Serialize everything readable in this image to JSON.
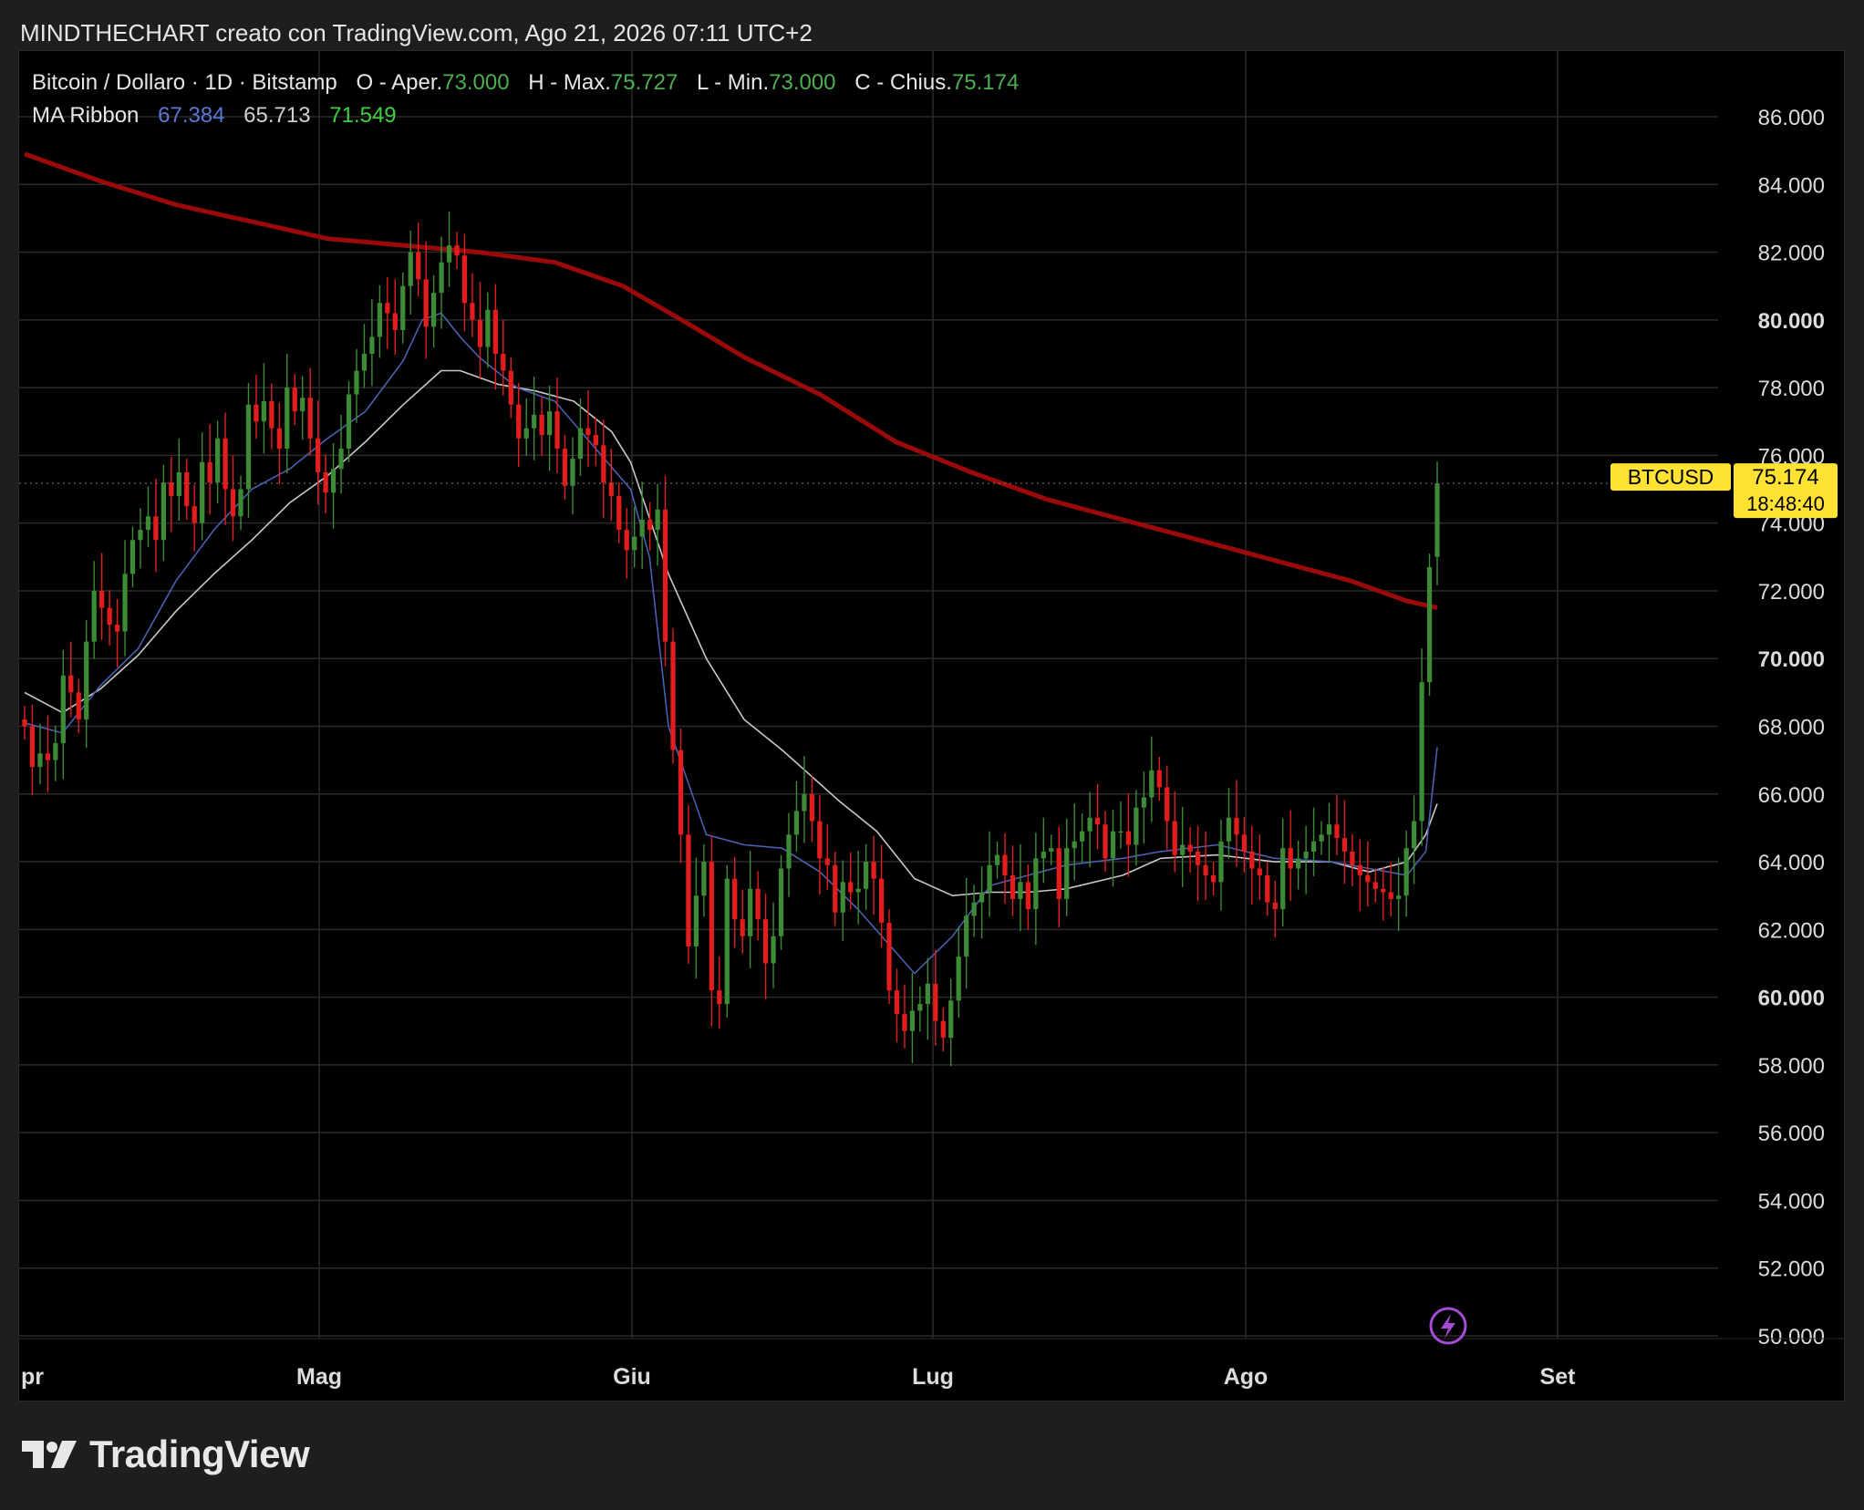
{
  "header": {
    "text": "MINDTHECHART creato con TradingView.com, Ago 21, 2026 07:11 UTC+2"
  },
  "legend": {
    "symbol": "Bitcoin / Dollaro · 1D · Bitstamp",
    "open_label": "O - Aper.",
    "open_value": "73.000",
    "high_label": "H - Max.",
    "high_value": "75.727",
    "low_label": "L - Min.",
    "low_value": "73.000",
    "close_label": "C - Chius.",
    "close_value": "75.174",
    "ma_label": "MA Ribbon",
    "ma_values": [
      "67.384",
      "65.713",
      "71.549"
    ]
  },
  "colors": {
    "up": "#3d8b37",
    "down": "#e31d1d",
    "ma_long": "#9b0a0a",
    "ma_fast": "#4a5fb0",
    "ma_mid": "#c8c8c8",
    "ma_val1": "#5b77d6",
    "ma_val2": "#d0d0d0",
    "ma_val3": "#3fd13f",
    "price_tag": "#ffe233",
    "grid": "#2b2b2b",
    "axis_text": "#dcdcdc"
  },
  "price_tag": {
    "symbol": "BTCUSD",
    "price": "75.174",
    "countdown": "18:48:40"
  },
  "footer": {
    "brand": "TradingView"
  },
  "icons": {
    "bolt": "lightning-icon"
  },
  "chart_data": {
    "type": "candlestick",
    "title": "",
    "ylim": [
      50000,
      86000
    ],
    "y_ticks": [
      "50.000",
      "52.000",
      "54.000",
      "56.000",
      "58.000",
      "60.000",
      "62.000",
      "64.000",
      "66.000",
      "68.000",
      "70.000",
      "72.000",
      "74.000",
      "76.000",
      "78.000",
      "80.000",
      "82.000",
      "84.000",
      "86.000"
    ],
    "bold_ticks": [
      "60.000",
      "70.000",
      "80.000"
    ],
    "x_labels": [
      {
        "label": "pr",
        "date": "2026-04-01"
      },
      {
        "label": "Mag",
        "date": "2026-05-01"
      },
      {
        "label": "Giu",
        "date": "2026-06-01"
      },
      {
        "label": "Lug",
        "date": "2026-07-01"
      },
      {
        "label": "Ago",
        "date": "2026-08-01"
      },
      {
        "label": "Set",
        "date": "2026-09-01"
      }
    ],
    "last_price": 75174,
    "candles_close": [
      68000,
      66800,
      67200,
      67000,
      67500,
      69500,
      69000,
      68200,
      70500,
      72000,
      71500,
      71000,
      70800,
      72500,
      73500,
      73800,
      74200,
      73500,
      75200,
      74800,
      75500,
      74500,
      74000,
      75800,
      75200,
      76500,
      75000,
      74200,
      75000,
      77500,
      77000,
      77600,
      76800,
      76200,
      78000,
      77300,
      77700,
      76500,
      75500,
      74900,
      75600,
      76200,
      77800,
      78500,
      79000,
      79500,
      80500,
      80200,
      79700,
      81000,
      82000,
      81200,
      79800,
      80800,
      81700,
      82200,
      81900,
      80500,
      80000,
      79200,
      80300,
      79000,
      78500,
      77500,
      76500,
      76800,
      77200,
      76600,
      77300,
      76200,
      75100,
      75900,
      76800,
      76600,
      76300,
      75200,
      74800,
      73800,
      73200,
      73600,
      74100,
      73800,
      74400,
      70500,
      67300,
      64800,
      61500,
      63000,
      64000,
      60200,
      59800,
      63500,
      62300,
      61800,
      63200,
      62300,
      61000,
      61800,
      63800,
      64800,
      65500,
      66000,
      65200,
      64100,
      63900,
      62500,
      63400,
      63100,
      63200,
      64000,
      63500,
      62200,
      60200,
      59500,
      59000,
      59600,
      59800,
      60400,
      59300,
      58800,
      59900,
      61200,
      62400,
      62800,
      63100,
      63900,
      64200,
      63600,
      62900,
      63400,
      62600,
      64100,
      64300,
      64400,
      62900,
      64400,
      64600,
      64900,
      65300,
      65100,
      64100,
      64900,
      64900,
      64500,
      65600,
      65900,
      66700,
      66200,
      65200,
      64200,
      64500,
      64300,
      63900,
      63600,
      63400,
      64600,
      65300,
      64800,
      64300,
      63800,
      63600,
      62800,
      62600,
      64400,
      63800,
      64100,
      64300,
      64600,
      64800,
      65100,
      64700,
      64300,
      63900,
      63600,
      63400,
      63200,
      63100,
      62900,
      63000,
      64400,
      65200,
      69300,
      72700,
      75174
    ],
    "candles_open": [
      68200,
      68000,
      66800,
      67200,
      67000,
      67500,
      69500,
      69000,
      68200,
      70500,
      72000,
      71500,
      71000,
      70800,
      72500,
      73500,
      73800,
      74200,
      73500,
      75200,
      74800,
      75500,
      74500,
      74000,
      75800,
      75200,
      76500,
      75000,
      74200,
      75000,
      77500,
      77000,
      77600,
      76800,
      76200,
      78000,
      77300,
      77700,
      76500,
      75500,
      74900,
      75600,
      76200,
      77800,
      78500,
      79000,
      79500,
      80500,
      80200,
      79700,
      81000,
      82000,
      81200,
      79800,
      80800,
      81700,
      82200,
      81900,
      80500,
      80000,
      79200,
      80300,
      79000,
      78500,
      77500,
      76500,
      76800,
      77200,
      76600,
      77300,
      76200,
      75100,
      75900,
      76800,
      76600,
      76300,
      75200,
      74800,
      73800,
      73200,
      73600,
      74100,
      73800,
      74400,
      70500,
      67300,
      64800,
      61500,
      63000,
      64000,
      60200,
      59800,
      63500,
      62300,
      61800,
      63200,
      62300,
      61000,
      61800,
      63800,
      64800,
      65500,
      66000,
      65200,
      64100,
      63900,
      62500,
      63400,
      63100,
      63200,
      64000,
      63500,
      62200,
      60200,
      59500,
      59000,
      59600,
      59800,
      60400,
      59300,
      58800,
      59900,
      61200,
      62400,
      62800,
      63100,
      63900,
      64200,
      63600,
      62900,
      63400,
      62600,
      64100,
      64300,
      64400,
      62900,
      64400,
      64600,
      64900,
      65300,
      65100,
      64100,
      64900,
      64900,
      64500,
      65600,
      65900,
      66700,
      66200,
      65200,
      64200,
      64500,
      64300,
      63900,
      63600,
      63400,
      64600,
      65300,
      64800,
      64300,
      63800,
      63600,
      62800,
      62600,
      64400,
      63800,
      64100,
      64300,
      64600,
      64800,
      65100,
      64700,
      64300,
      63900,
      63600,
      63400,
      63200,
      63100,
      62900,
      63000,
      64400,
      65200,
      69300,
      73000
    ],
    "ma_long_points": [
      [
        0,
        84900
      ],
      [
        20,
        84100
      ],
      [
        40,
        83400
      ],
      [
        60,
        82900
      ],
      [
        80,
        82400
      ],
      [
        100,
        82200
      ],
      [
        120,
        82000
      ],
      [
        140,
        81700
      ],
      [
        158,
        81000
      ],
      [
        175,
        79900
      ],
      [
        190,
        78900
      ],
      [
        210,
        77800
      ],
      [
        230,
        76400
      ],
      [
        250,
        75500
      ],
      [
        270,
        74700
      ],
      [
        290,
        74100
      ],
      [
        310,
        73500
      ],
      [
        330,
        72900
      ],
      [
        350,
        72300
      ],
      [
        365,
        71700
      ],
      [
        373,
        71500
      ]
    ],
    "ma_fast_points": [
      [
        0,
        68100
      ],
      [
        10,
        67800
      ],
      [
        20,
        69200
      ],
      [
        30,
        70300
      ],
      [
        40,
        72300
      ],
      [
        50,
        73800
      ],
      [
        60,
        75000
      ],
      [
        70,
        75600
      ],
      [
        80,
        76500
      ],
      [
        90,
        77300
      ],
      [
        100,
        78800
      ],
      [
        105,
        80000
      ],
      [
        110,
        80200
      ],
      [
        115,
        79500
      ],
      [
        120,
        78900
      ],
      [
        130,
        78000
      ],
      [
        140,
        77600
      ],
      [
        150,
        76300
      ],
      [
        160,
        75000
      ],
      [
        165,
        73000
      ],
      [
        170,
        68000
      ],
      [
        180,
        64800
      ],
      [
        190,
        64500
      ],
      [
        200,
        64400
      ],
      [
        210,
        63700
      ],
      [
        220,
        62600
      ],
      [
        235,
        60700
      ],
      [
        245,
        61800
      ],
      [
        255,
        63300
      ],
      [
        265,
        63600
      ],
      [
        275,
        63900
      ],
      [
        290,
        64100
      ],
      [
        300,
        64300
      ],
      [
        315,
        64500
      ],
      [
        330,
        64100
      ],
      [
        345,
        64000
      ],
      [
        355,
        63800
      ],
      [
        365,
        63600
      ],
      [
        370,
        64300
      ],
      [
        373,
        67384
      ]
    ],
    "ma_mid_points": [
      [
        0,
        69000
      ],
      [
        10,
        68400
      ],
      [
        20,
        69100
      ],
      [
        30,
        70100
      ],
      [
        40,
        71400
      ],
      [
        50,
        72500
      ],
      [
        60,
        73500
      ],
      [
        70,
        74600
      ],
      [
        80,
        75400
      ],
      [
        90,
        76400
      ],
      [
        100,
        77500
      ],
      [
        110,
        78500
      ],
      [
        115,
        78500
      ],
      [
        125,
        78100
      ],
      [
        135,
        77900
      ],
      [
        145,
        77600
      ],
      [
        155,
        76700
      ],
      [
        160,
        75800
      ],
      [
        170,
        72500
      ],
      [
        180,
        70000
      ],
      [
        190,
        68200
      ],
      [
        200,
        67300
      ],
      [
        215,
        65800
      ],
      [
        225,
        64900
      ],
      [
        235,
        63500
      ],
      [
        245,
        63000
      ],
      [
        255,
        63100
      ],
      [
        265,
        63100
      ],
      [
        275,
        63200
      ],
      [
        290,
        63600
      ],
      [
        300,
        64100
      ],
      [
        315,
        64200
      ],
      [
        330,
        64000
      ],
      [
        345,
        64000
      ],
      [
        355,
        63700
      ],
      [
        365,
        64000
      ],
      [
        370,
        64800
      ],
      [
        373,
        65713
      ]
    ]
  }
}
